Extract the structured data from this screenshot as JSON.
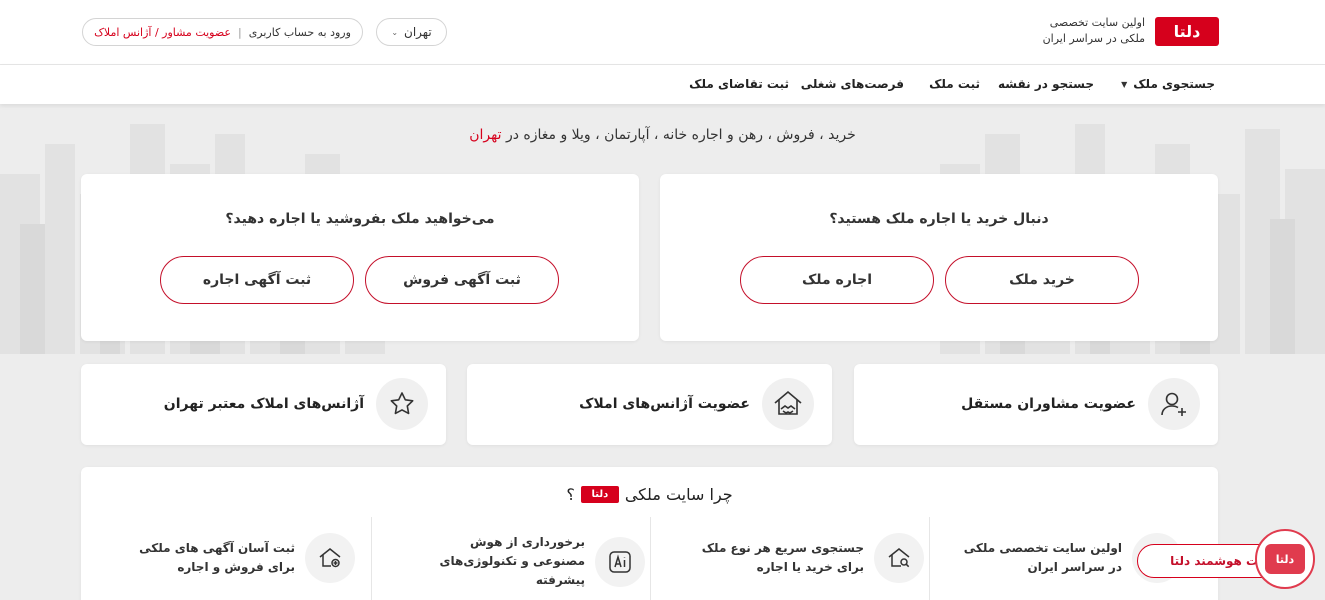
{
  "header": {
    "logo_text": "دلتا",
    "tagline_line1": "اولین سایت تخصصی",
    "tagline_line2": "ملکی در سراسر ایران",
    "login_label": "ورود به حساب کاربری",
    "login_sep": "|",
    "membership_label": "عضویت مشاور / آژانس املاک",
    "city_selected": "تهران"
  },
  "nav": {
    "items": [
      {
        "label": "جستجوی ملک",
        "has_dropdown": true
      },
      {
        "label": "جستجو در نقشه"
      },
      {
        "label": "ثبت ملک"
      },
      {
        "label": "فرصت‌های شغلی"
      },
      {
        "label": "ثبت تقاضای ملک"
      }
    ]
  },
  "hero": {
    "headline_prefix": "خرید ، فروش ، رهن و اجاره خانه ، آپارتمان ، ویلا و مغازه در",
    "headline_city": "تهران"
  },
  "buy_card": {
    "title": "دنبال خرید یا اجاره ملک هستید؟",
    "buy_button": "خرید ملک",
    "rent_button": "اجاره ملک"
  },
  "sell_card": {
    "title": "می‌خواهید ملک بفروشید یا اجاره دهید؟",
    "sale_ad_button": "ثبت آگهی فروش",
    "rent_ad_button": "ثبت آگهی اجاره"
  },
  "features": [
    {
      "label": "عضویت مشاوران مستقل",
      "icon": "user-plus-icon"
    },
    {
      "label": "عضویت آژانس‌های املاک",
      "icon": "house-handshake-icon"
    },
    {
      "label": "آژانس‌های املاک معتبر تهران",
      "icon": "star-icon"
    }
  ],
  "why": {
    "title_prefix": "چرا سایت ملکی",
    "title_logo": "دلتا",
    "title_suffix": "؟",
    "items": [
      {
        "text": "اولین سایت تخصصی ملکی در سراسر ایران",
        "icon": "building-icon"
      },
      {
        "text": "جستجوی سریع هر نوع ملک برای خرید یا اجاره",
        "icon": "house-search-icon"
      },
      {
        "text": "برخورداری از هوش مصنوعی و تکنولوژی‌های پیشرفته",
        "icon": "ai-icon"
      },
      {
        "text": "ثبت آسان آگهی های ملکی برای فروش و اجاره",
        "icon": "house-add-icon"
      }
    ]
  },
  "bot": {
    "label": "ربات هوشمند دلتا",
    "logo_text": "دلتا"
  },
  "colors": {
    "brand": "#d6001c",
    "button_border": "#c40f2a",
    "background": "#ededed"
  }
}
